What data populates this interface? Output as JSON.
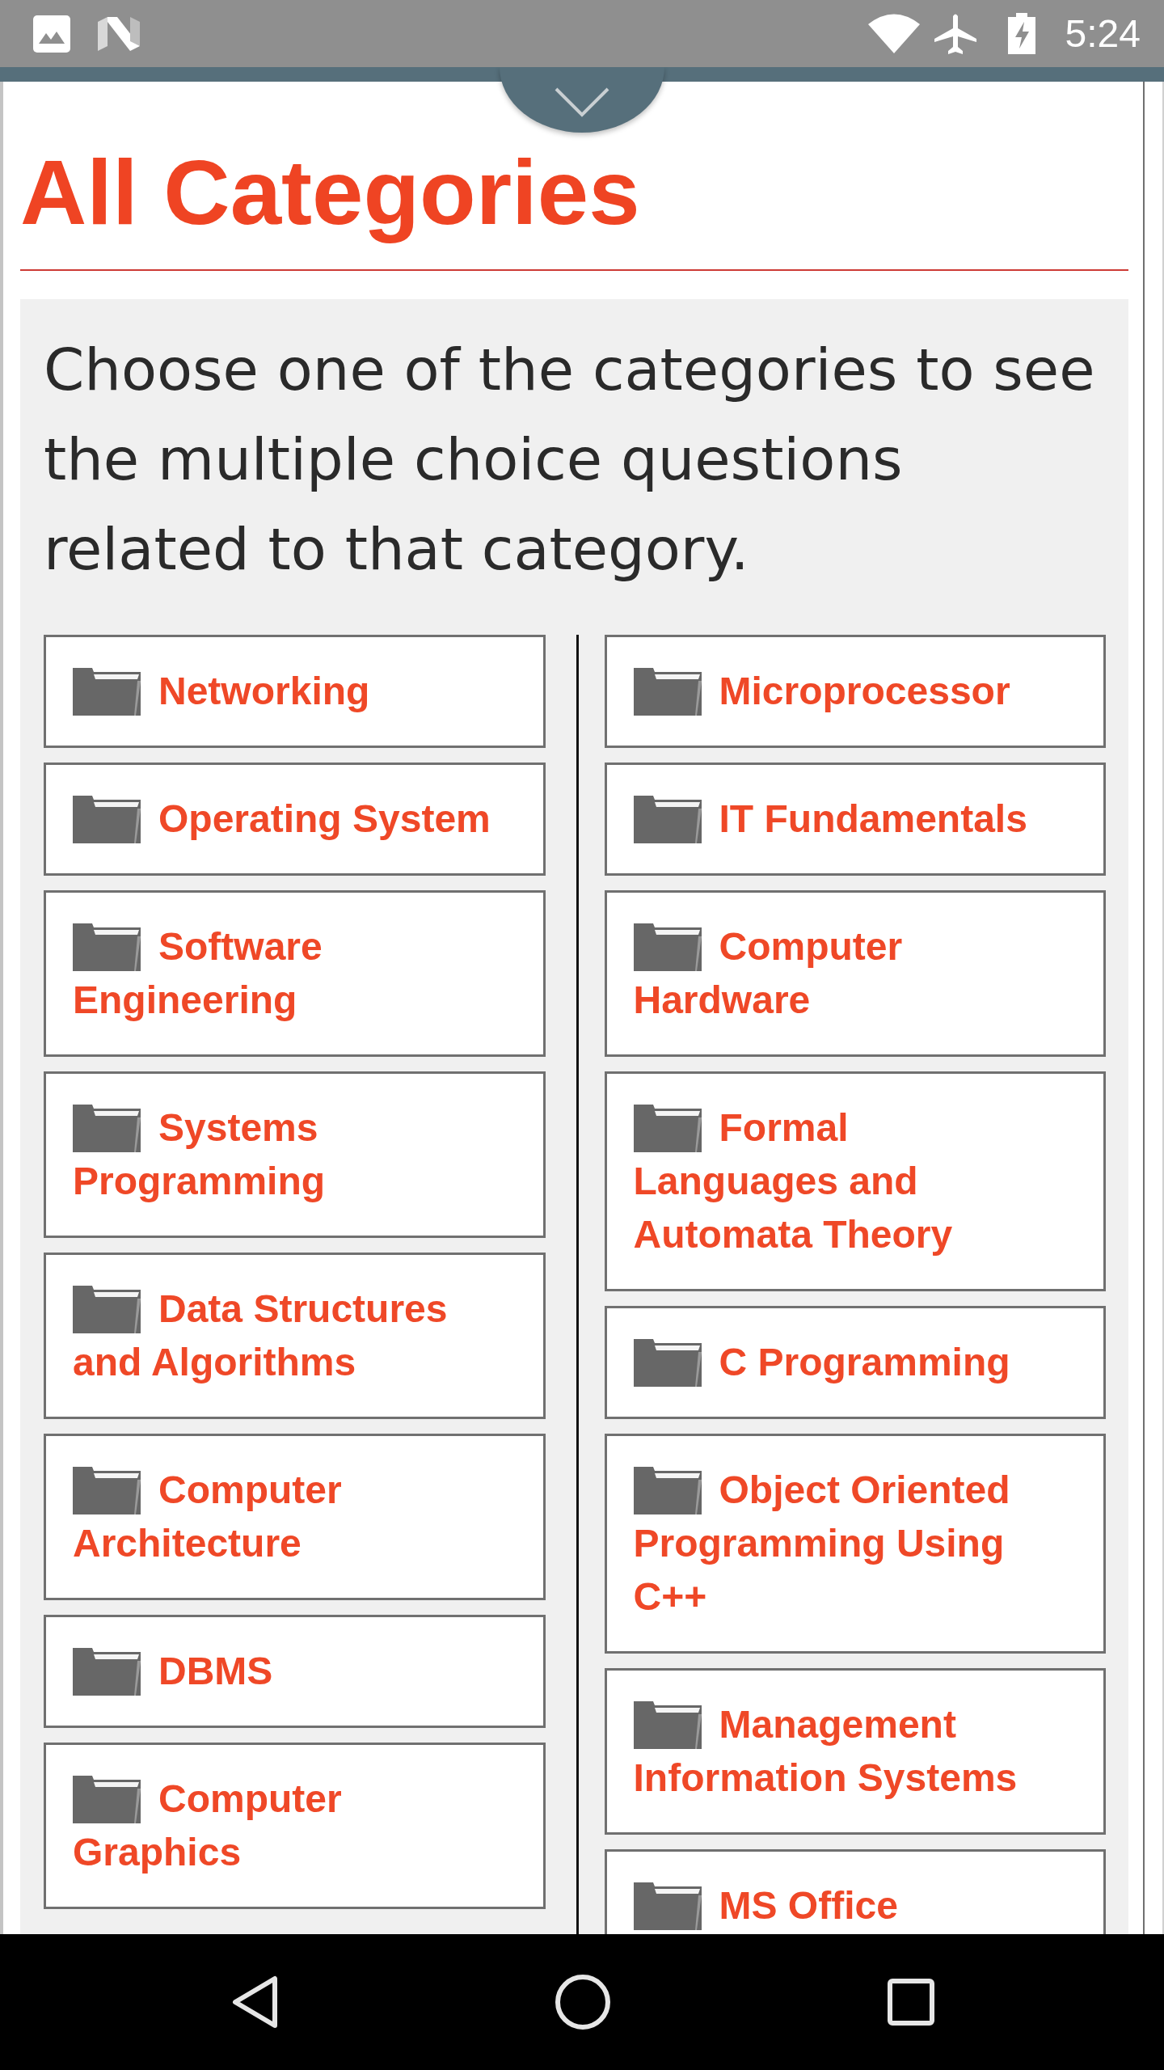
{
  "status_bar": {
    "time": "5:24"
  },
  "page": {
    "title": "All Categories"
  },
  "categories_panel": {
    "intro": "Choose one of the categories to see the multiple choice questions related to that category.",
    "columns": [
      {
        "items": [
          {
            "label": "Networking"
          },
          {
            "label": "Operating System"
          },
          {
            "label": "Software Engineering"
          },
          {
            "label": "Systems Programming"
          },
          {
            "label": "Data Structures and Algorithms"
          },
          {
            "label": "Computer Architecture"
          },
          {
            "label": "DBMS"
          },
          {
            "label": "Computer Graphics"
          }
        ]
      },
      {
        "items": [
          {
            "label": "Microprocessor"
          },
          {
            "label": "IT Fundamentals"
          },
          {
            "label": "Computer Hardware"
          },
          {
            "label": "Formal Languages and Automata Theory"
          },
          {
            "label": "C Programming"
          },
          {
            "label": "Object Oriented Programming Using C++"
          },
          {
            "label": "Management Information Systems"
          },
          {
            "label": "MS Office"
          }
        ]
      }
    ]
  }
}
